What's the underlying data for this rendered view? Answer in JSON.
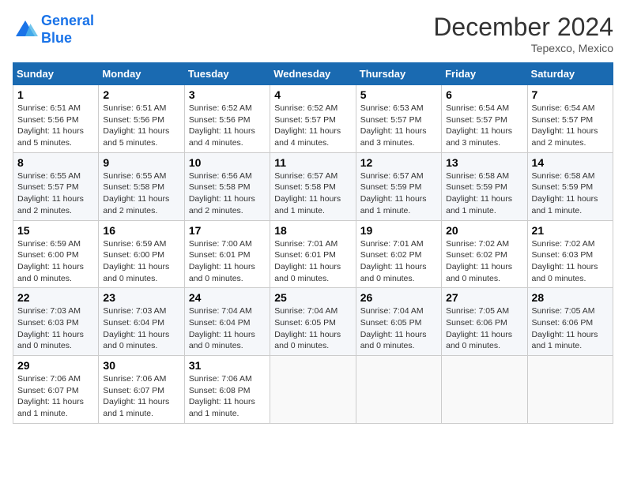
{
  "header": {
    "logo_line1": "General",
    "logo_line2": "Blue",
    "month_title": "December 2024",
    "location": "Tepexco, Mexico"
  },
  "weekdays": [
    "Sunday",
    "Monday",
    "Tuesday",
    "Wednesday",
    "Thursday",
    "Friday",
    "Saturday"
  ],
  "weeks": [
    [
      {
        "day": "1",
        "sunrise": "6:51 AM",
        "sunset": "5:56 PM",
        "daylight": "11 hours and 5 minutes."
      },
      {
        "day": "2",
        "sunrise": "6:51 AM",
        "sunset": "5:56 PM",
        "daylight": "11 hours and 5 minutes."
      },
      {
        "day": "3",
        "sunrise": "6:52 AM",
        "sunset": "5:56 PM",
        "daylight": "11 hours and 4 minutes."
      },
      {
        "day": "4",
        "sunrise": "6:52 AM",
        "sunset": "5:57 PM",
        "daylight": "11 hours and 4 minutes."
      },
      {
        "day": "5",
        "sunrise": "6:53 AM",
        "sunset": "5:57 PM",
        "daylight": "11 hours and 3 minutes."
      },
      {
        "day": "6",
        "sunrise": "6:54 AM",
        "sunset": "5:57 PM",
        "daylight": "11 hours and 3 minutes."
      },
      {
        "day": "7",
        "sunrise": "6:54 AM",
        "sunset": "5:57 PM",
        "daylight": "11 hours and 2 minutes."
      }
    ],
    [
      {
        "day": "8",
        "sunrise": "6:55 AM",
        "sunset": "5:57 PM",
        "daylight": "11 hours and 2 minutes."
      },
      {
        "day": "9",
        "sunrise": "6:55 AM",
        "sunset": "5:58 PM",
        "daylight": "11 hours and 2 minutes."
      },
      {
        "day": "10",
        "sunrise": "6:56 AM",
        "sunset": "5:58 PM",
        "daylight": "11 hours and 2 minutes."
      },
      {
        "day": "11",
        "sunrise": "6:57 AM",
        "sunset": "5:58 PM",
        "daylight": "11 hours and 1 minute."
      },
      {
        "day": "12",
        "sunrise": "6:57 AM",
        "sunset": "5:59 PM",
        "daylight": "11 hours and 1 minute."
      },
      {
        "day": "13",
        "sunrise": "6:58 AM",
        "sunset": "5:59 PM",
        "daylight": "11 hours and 1 minute."
      },
      {
        "day": "14",
        "sunrise": "6:58 AM",
        "sunset": "5:59 PM",
        "daylight": "11 hours and 1 minute."
      }
    ],
    [
      {
        "day": "15",
        "sunrise": "6:59 AM",
        "sunset": "6:00 PM",
        "daylight": "11 hours and 0 minutes."
      },
      {
        "day": "16",
        "sunrise": "6:59 AM",
        "sunset": "6:00 PM",
        "daylight": "11 hours and 0 minutes."
      },
      {
        "day": "17",
        "sunrise": "7:00 AM",
        "sunset": "6:01 PM",
        "daylight": "11 hours and 0 minutes."
      },
      {
        "day": "18",
        "sunrise": "7:01 AM",
        "sunset": "6:01 PM",
        "daylight": "11 hours and 0 minutes."
      },
      {
        "day": "19",
        "sunrise": "7:01 AM",
        "sunset": "6:02 PM",
        "daylight": "11 hours and 0 minutes."
      },
      {
        "day": "20",
        "sunrise": "7:02 AM",
        "sunset": "6:02 PM",
        "daylight": "11 hours and 0 minutes."
      },
      {
        "day": "21",
        "sunrise": "7:02 AM",
        "sunset": "6:03 PM",
        "daylight": "11 hours and 0 minutes."
      }
    ],
    [
      {
        "day": "22",
        "sunrise": "7:03 AM",
        "sunset": "6:03 PM",
        "daylight": "11 hours and 0 minutes."
      },
      {
        "day": "23",
        "sunrise": "7:03 AM",
        "sunset": "6:04 PM",
        "daylight": "11 hours and 0 minutes."
      },
      {
        "day": "24",
        "sunrise": "7:04 AM",
        "sunset": "6:04 PM",
        "daylight": "11 hours and 0 minutes."
      },
      {
        "day": "25",
        "sunrise": "7:04 AM",
        "sunset": "6:05 PM",
        "daylight": "11 hours and 0 minutes."
      },
      {
        "day": "26",
        "sunrise": "7:04 AM",
        "sunset": "6:05 PM",
        "daylight": "11 hours and 0 minutes."
      },
      {
        "day": "27",
        "sunrise": "7:05 AM",
        "sunset": "6:06 PM",
        "daylight": "11 hours and 0 minutes."
      },
      {
        "day": "28",
        "sunrise": "7:05 AM",
        "sunset": "6:06 PM",
        "daylight": "11 hours and 1 minute."
      }
    ],
    [
      {
        "day": "29",
        "sunrise": "7:06 AM",
        "sunset": "6:07 PM",
        "daylight": "11 hours and 1 minute."
      },
      {
        "day": "30",
        "sunrise": "7:06 AM",
        "sunset": "6:07 PM",
        "daylight": "11 hours and 1 minute."
      },
      {
        "day": "31",
        "sunrise": "7:06 AM",
        "sunset": "6:08 PM",
        "daylight": "11 hours and 1 minute."
      },
      null,
      null,
      null,
      null
    ]
  ]
}
